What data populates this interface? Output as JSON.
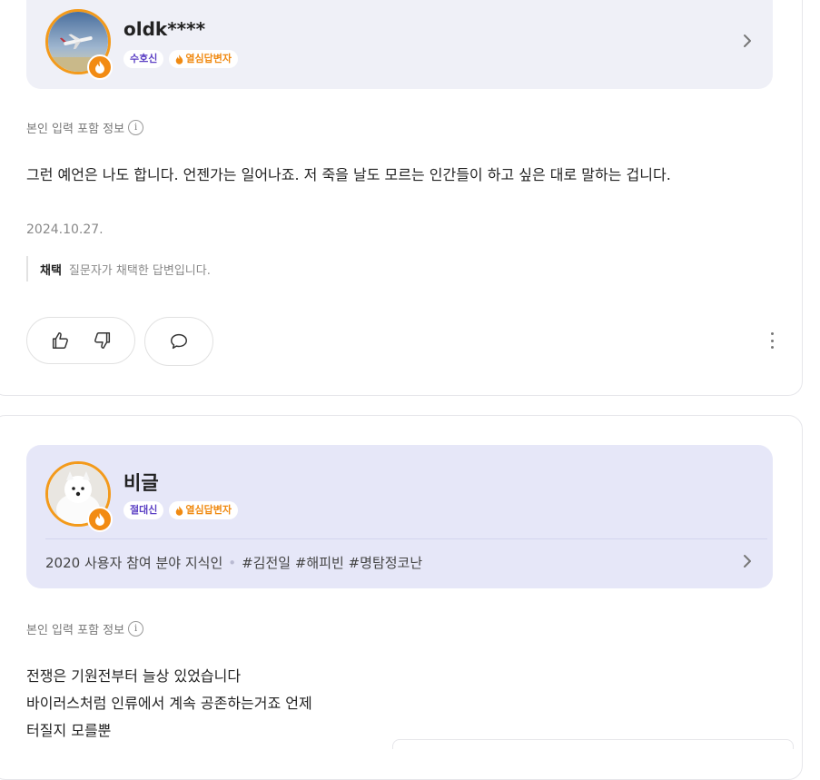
{
  "answers": [
    {
      "user": {
        "name": "oldk****",
        "rank_badge": "수호신",
        "fire_badge": "열심답변자"
      },
      "info_label": "본인 입력 포함 정보",
      "text_lines": [
        "그런 예언은 나도 합니다. 언젠가는 일어나죠. 저 죽을 날도 모르는 인간들이 하고 싶은 대로 말하는 겁니다."
      ],
      "date": "2024.10.27.",
      "adopted": {
        "label": "채택",
        "text": "질문자가 채택한 답변입니다."
      }
    },
    {
      "user": {
        "name": "비글",
        "rank_badge": "절대신",
        "fire_badge": "열심답변자",
        "intro": "2020 사용자 참여 분야 지식인",
        "tags": "#김전일 #해피빈 #명탐정코난"
      },
      "info_label": "본인 입력 포함 정보",
      "text_lines": [
        "전쟁은 기원전부터 늘상 있었습니다",
        "바이러스처럼 인류에서 계속 공존하는거죠 언제",
        "터질지 모를뿐"
      ]
    }
  ],
  "colors": {
    "accent_orange": "#f28b13",
    "rank_purple": "#5b3fc4",
    "profile_bg_1": "#eff0f7",
    "profile_bg_2": "#e6e7f8"
  },
  "icons": {
    "info": "i"
  }
}
